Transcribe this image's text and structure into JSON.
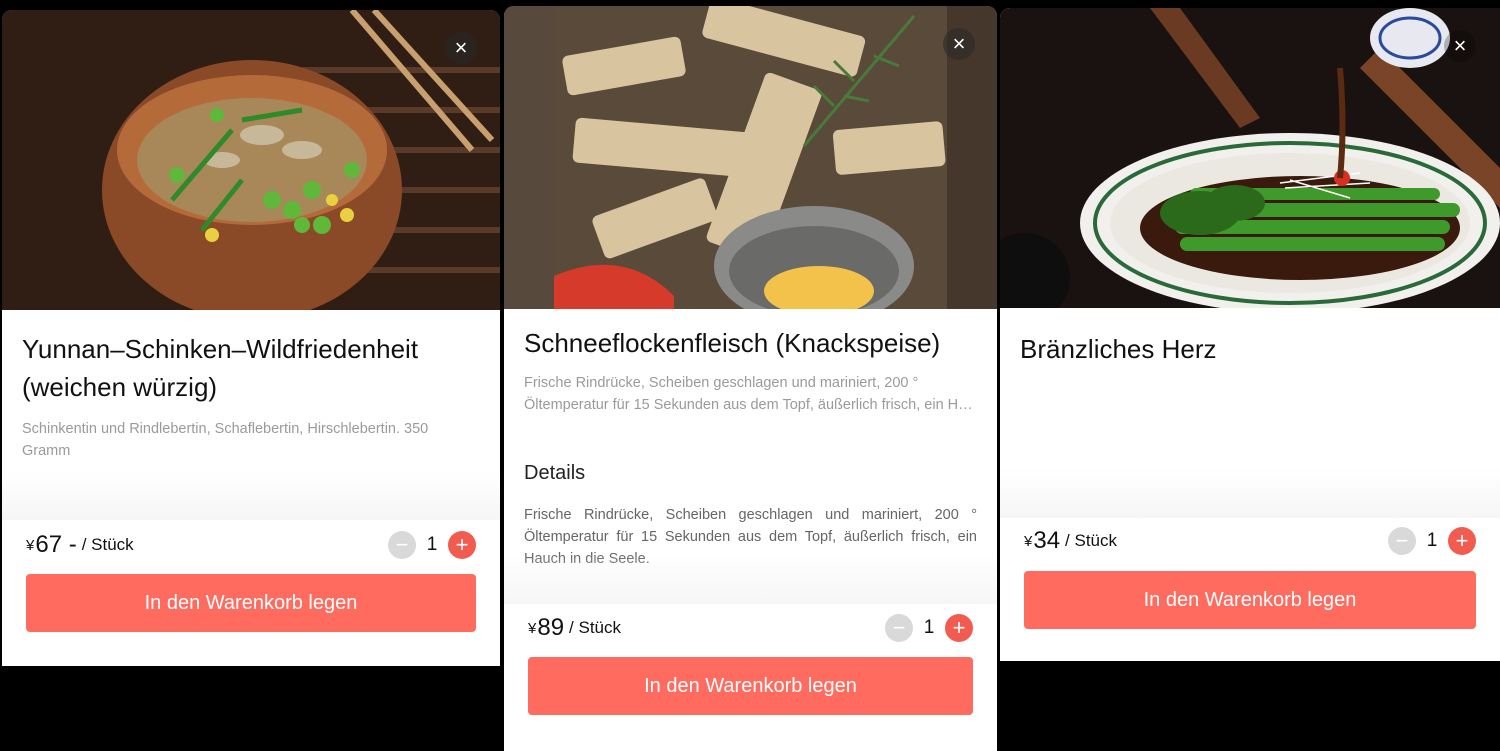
{
  "cards": [
    {
      "title": "Yunnan–Schinken–Wildfriedenheit (weichen würzig)",
      "description": "Schinkentin und Rindlebertin, Schaflebertin, Hirschlebertin. 350 Gramm",
      "currency": "¥",
      "price": "67 -",
      "unit": "/ Stück",
      "quantity": "1",
      "close_label": "×",
      "minus_label": "−",
      "plus_label": "+",
      "cart_label": "In den Warenkorb legen"
    },
    {
      "title": "Schneeflockenfleisch (Knackspeise)",
      "description": "Frische Rindrücke, Scheiben geschlagen und mariniert, 200 ° Öltemperatur für 15 Sekunden aus dem Topf, äußerlich frisch, ein H…",
      "details_heading": "Details",
      "details_text": "Frische Rindrücke, Scheiben geschlagen und mariniert, 200 ° Öltemperatur für 15 Sekunden aus dem Topf, äußerlich frisch, ein Hauch in die Seele.",
      "currency": "¥",
      "price": "89",
      "unit": "/ Stück",
      "quantity": "1",
      "close_label": "×",
      "minus_label": "−",
      "plus_label": "+",
      "cart_label": "In den Warenkorb legen"
    },
    {
      "title": "Bränzliches Herz",
      "currency": "¥",
      "price": "34",
      "unit": "/ Stück",
      "quantity": "1",
      "close_label": "×",
      "minus_label": "−",
      "plus_label": "+",
      "cart_label": "In den Warenkorb legen"
    }
  ],
  "colors": {
    "accent": "#ff6b5f",
    "plus_button": "#f25b50",
    "minus_button": "#d9d9d9",
    "background": "#000000"
  },
  "icons": [
    "close-icon",
    "minus-icon",
    "plus-icon"
  ]
}
